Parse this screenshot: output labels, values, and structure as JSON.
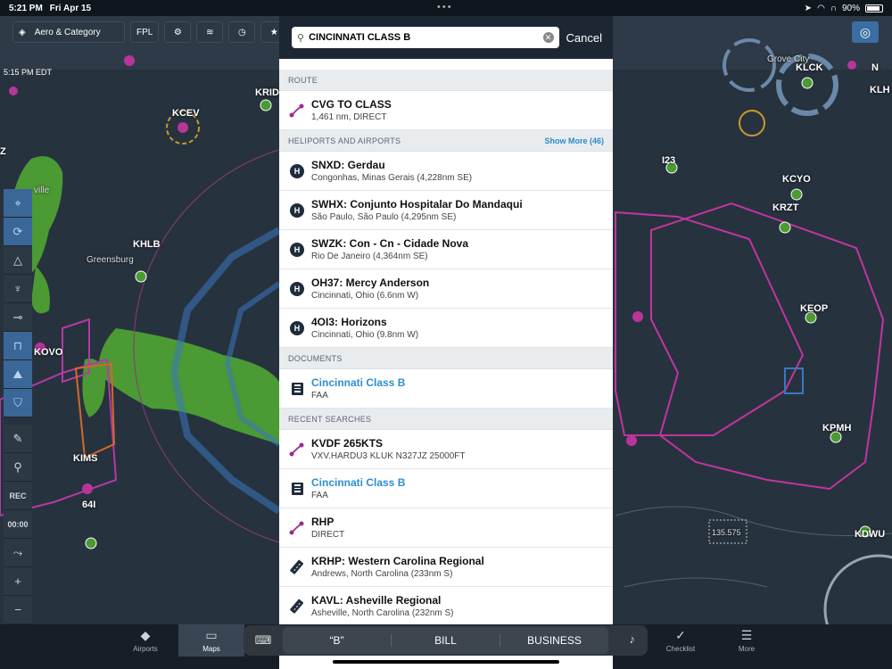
{
  "status_bar": {
    "time": "5:21 PM",
    "date": "Fri Apr 15",
    "battery": "90%",
    "battery_level": 0.9
  },
  "map": {
    "time_label": "5:15 PM EDT",
    "toolbar": {
      "layers_label": "Aero & Category",
      "fpl_label": "FPL"
    },
    "labels": [
      "KCEV",
      "KRID",
      "KHLB",
      "Greensburg",
      "KOVO",
      "KIMS",
      "64I",
      "I23",
      "KCYO",
      "KRZT",
      "KEOP",
      "KPMH",
      "KDWU",
      "KLCK",
      "KLH",
      "Grove City",
      "N",
      "ville",
      "Z"
    ],
    "side_tools": {
      "rec_label": "REC",
      "timer_label": "00:00"
    },
    "sectional_label": "135.575"
  },
  "search": {
    "query": "CINCINNATI CLASS B",
    "cancel_label": "Cancel",
    "sections": {
      "route": {
        "title": "ROUTE",
        "items": [
          {
            "title": "CVG TO CLASS",
            "subtitle": "1,461 nm, DIRECT",
            "icon": "route-icon"
          }
        ]
      },
      "heliports": {
        "title": "HELIPORTS AND AIRPORTS",
        "show_more": "Show More (46)",
        "items": [
          {
            "title": "SNXD: Gerdau",
            "subtitle": "Congonhas, Minas Gerais  (4,228nm SE)",
            "icon": "heliport-icon"
          },
          {
            "title": "SWHX: Conjunto Hospitalar Do Mandaqui",
            "subtitle": "São Paulo, São Paulo  (4,295nm SE)",
            "icon": "heliport-icon"
          },
          {
            "title": "SWZK: Con - Cn - Cidade Nova",
            "subtitle": "Rio De Janeiro  (4,364nm SE)",
            "icon": "heliport-icon"
          },
          {
            "title": "OH37: Mercy Anderson",
            "subtitle": "Cincinnati, Ohio  (6.6nm W)",
            "icon": "heliport-icon"
          },
          {
            "title": "4OI3: Horizons",
            "subtitle": "Cincinnati, Ohio  (9.8nm W)",
            "icon": "heliport-icon"
          }
        ]
      },
      "documents": {
        "title": "DOCUMENTS",
        "items": [
          {
            "title": "Cincinnati Class B",
            "subtitle": "FAA",
            "icon": "document-icon"
          }
        ]
      },
      "recent": {
        "title": "RECENT SEARCHES",
        "items": [
          {
            "title": "KVDF 265KTS",
            "subtitle": "VXV.HARDU3 KLUK N327JZ 25000FT",
            "icon": "route-icon"
          },
          {
            "title": "Cincinnati Class B",
            "subtitle": "FAA",
            "icon": "document-icon"
          },
          {
            "title": "RHP",
            "subtitle": "DIRECT",
            "icon": "route-icon"
          },
          {
            "title": "KRHP: Western Carolina Regional",
            "subtitle": "Andrews, North Carolina  (233nm S)",
            "icon": "runway-icon"
          },
          {
            "title": "KAVL: Asheville Regional",
            "subtitle": "Asheville, North Carolina  (232nm S)",
            "icon": "runway-icon"
          }
        ]
      }
    }
  },
  "tabs": {
    "airports": "Airports",
    "maps": "Maps",
    "checklist": "Checklist",
    "more": "More"
  },
  "keyboard": {
    "suggestions": [
      "“B”",
      "BILL",
      "BUSINESS"
    ]
  }
}
